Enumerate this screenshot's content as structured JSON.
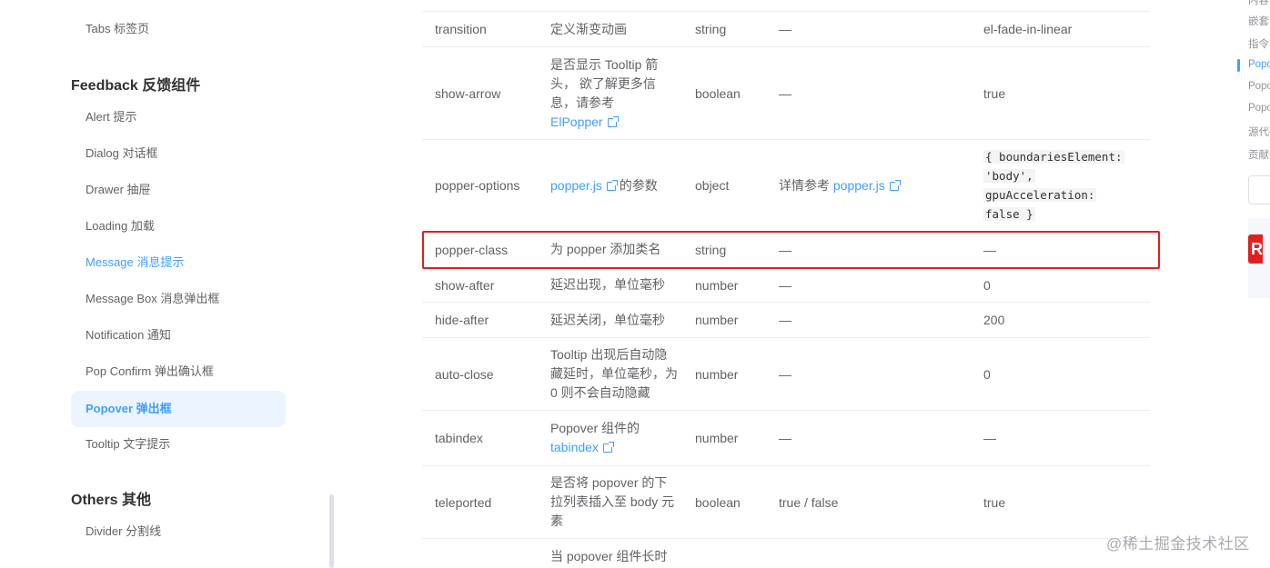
{
  "sidebar": {
    "tabs_item": "Tabs 标签页",
    "feedback_group": "Feedback 反馈组件",
    "items": [
      "Alert 提示",
      "Dialog 对话框",
      "Drawer 抽屉",
      "Loading 加载",
      "Message 消息提示",
      "Message Box 消息弹出框",
      "Notification 通知",
      "Pop Confirm 弹出确认框",
      "Popover 弹出框",
      "Tooltip 文字提示"
    ],
    "others_group": "Others 其他",
    "divider_item": "Divider 分割线"
  },
  "table": {
    "rows": [
      {
        "name": "transition",
        "desc": "定义渐变动画",
        "type": "string",
        "accepted": "—",
        "default": "el-fade-in-linear"
      },
      {
        "name": "show-arrow",
        "desc": "是否显示 Tooltip 箭头， 欲了解更多信息，请参考",
        "desc_link": "ElPopper",
        "type": "boolean",
        "accepted": "—",
        "default": "true"
      },
      {
        "name": "popper-options",
        "desc_link": "popper.js",
        "desc_suffix": "的参数",
        "type": "object",
        "accepted_prefix": "详情参考",
        "accepted_link": "popper.js",
        "default_code": [
          "{ boundariesElement:",
          "'body',",
          "gpuAcceleration:",
          "false }"
        ]
      },
      {
        "name": "popper-class",
        "desc": "为 popper 添加类名",
        "type": "string",
        "accepted": "—",
        "default": "—"
      },
      {
        "name": "show-after",
        "desc": "延迟出现，单位毫秒",
        "type": "number",
        "accepted": "—",
        "default": "0"
      },
      {
        "name": "hide-after",
        "desc": "延迟关闭，单位毫秒",
        "type": "number",
        "accepted": "—",
        "default": "200"
      },
      {
        "name": "auto-close",
        "desc": "Tooltip 出现后自动隐藏延时，单位毫秒，为 0 则不会自动隐藏",
        "type": "number",
        "accepted": "—",
        "default": "0"
      },
      {
        "name": "tabindex",
        "desc": "Popover 组件的",
        "desc_link": "tabindex",
        "type": "number",
        "accepted": "—",
        "default": "—"
      },
      {
        "name": "teleported",
        "desc": "是否将 popover 的下拉列表插入至 body 元素",
        "type": "boolean",
        "accepted": "true / false",
        "default": "true"
      },
      {
        "desc": "当 popover 组件长时"
      }
    ]
  },
  "toc": {
    "items": [
      "内容",
      "嵌套",
      "指令",
      "Popover",
      "Popover",
      "Popover",
      "源代码",
      "贡献者"
    ]
  },
  "watermark": "@稀土掘金技术社区",
  "colors": {
    "link": "#409eff",
    "active_bg": "#ecf5ff",
    "highlight_border": "#e02020"
  }
}
